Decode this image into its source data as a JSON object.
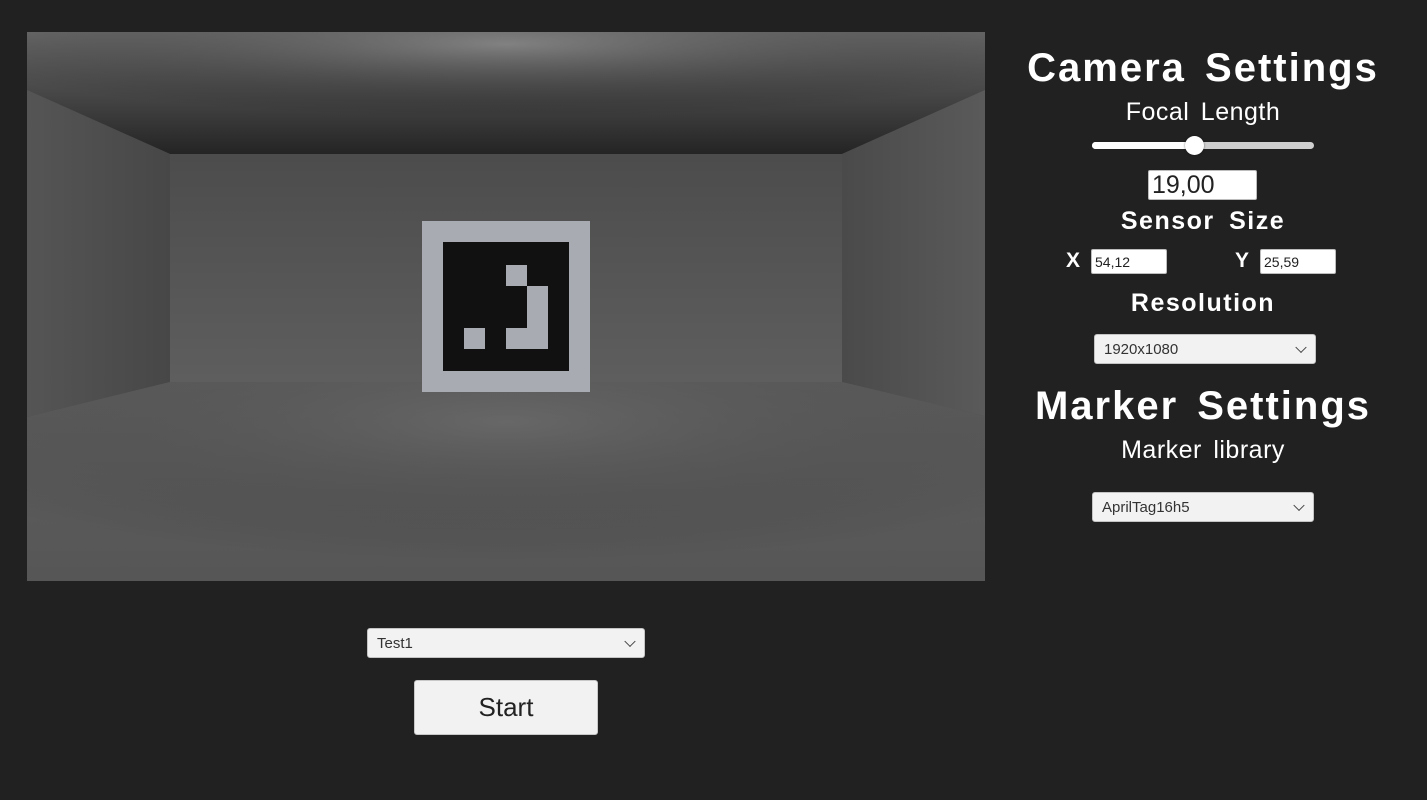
{
  "camera_settings": {
    "title": "Camera Settings",
    "focal_length": {
      "label": "Focal Length",
      "value": "19,00",
      "slider_fraction": 0.46
    },
    "sensor_size": {
      "title": "Sensor Size",
      "x_label": "X",
      "x_value": "54,12",
      "y_label": "Y",
      "y_value": "25,59"
    },
    "resolution": {
      "title": "Resolution",
      "selected": "1920x1080"
    }
  },
  "marker_settings": {
    "title": "Marker Settings",
    "library_label": "Marker library",
    "library_selected": "AprilTag16h5"
  },
  "scene_selector": {
    "selected": "Test1"
  },
  "start_button": {
    "label": "Start"
  },
  "icons": {
    "dropdown_chevron": "chevron-down-icon"
  },
  "colors": {
    "background": "#212121",
    "panel_text": "#ffffff",
    "control_bg": "#f2f2f2",
    "marker_border": "#a9abb2",
    "marker_black": "#111111"
  }
}
